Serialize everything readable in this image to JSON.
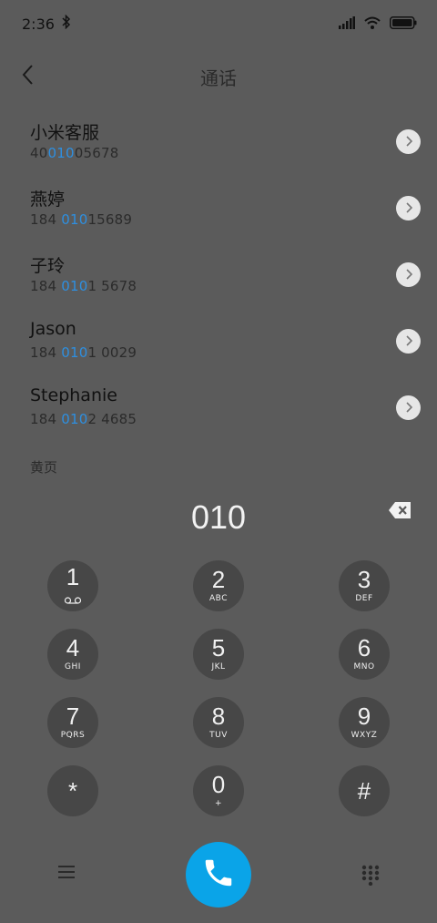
{
  "status_bar": {
    "time": "2:36"
  },
  "header": {
    "title": "通话"
  },
  "results": [
    {
      "name": "小米客服",
      "number_pre": "40",
      "number_match": "010",
      "number_post": "05678"
    },
    {
      "name": "燕婷",
      "number_pre": "184 ",
      "number_match": "010",
      "number_post": "15689"
    },
    {
      "name": "子玲",
      "number_pre": "184 ",
      "number_match": "010",
      "number_post": "1 5678"
    },
    {
      "name": "Jason",
      "number_pre": "184 ",
      "number_match": "010",
      "number_post": "1 0029"
    },
    {
      "name": "Stephanie",
      "number_pre": "184 ",
      "number_match": "010",
      "number_post": "2 4685"
    }
  ],
  "section_label": "黄页",
  "dial_entry": "010",
  "keypad": [
    {
      "digit": "1",
      "letters": ""
    },
    {
      "digit": "2",
      "letters": "ABC"
    },
    {
      "digit": "3",
      "letters": "DEF"
    },
    {
      "digit": "4",
      "letters": "GHI"
    },
    {
      "digit": "5",
      "letters": "JKL"
    },
    {
      "digit": "6",
      "letters": "MNO"
    },
    {
      "digit": "7",
      "letters": "PQRS"
    },
    {
      "digit": "8",
      "letters": "TUV"
    },
    {
      "digit": "9",
      "letters": "WXYZ"
    },
    {
      "digit": "*",
      "letters": ""
    },
    {
      "digit": "0",
      "letters": "+"
    },
    {
      "digit": "#",
      "letters": ""
    }
  ],
  "colors": {
    "accent": "#2e8fe0",
    "call": "#0aa4e8",
    "background": "#5b5b5b",
    "key": "#474747"
  },
  "icons": {
    "back": "chevron-left-icon",
    "detail": "chevron-right-icon",
    "delete": "backspace-icon",
    "menu": "hamburger-icon",
    "call": "phone-icon",
    "dialpad": "dialpad-icon"
  }
}
